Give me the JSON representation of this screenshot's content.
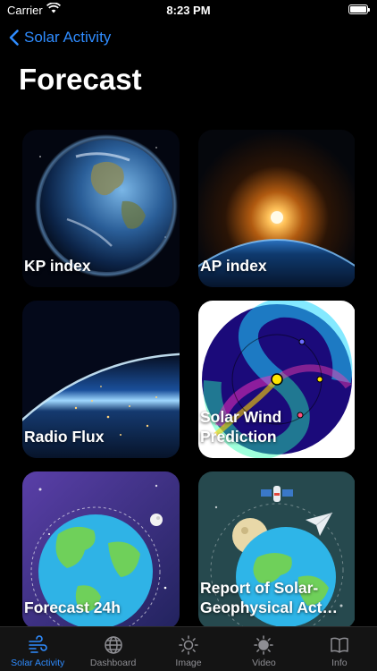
{
  "status_bar": {
    "carrier": "Carrier",
    "time": "8:23 PM"
  },
  "nav": {
    "back_label": "Solar Activity"
  },
  "page": {
    "title": "Forecast"
  },
  "cards": [
    {
      "label": "KP index",
      "image": "earth-from-space"
    },
    {
      "label": "AP index",
      "image": "sunrise-over-earth"
    },
    {
      "label": "Radio Flux",
      "image": "earth-city-lights"
    },
    {
      "label": "Solar Wind\nPrediction",
      "image": "solar-wind-spiral"
    },
    {
      "label": "Forecast 24h",
      "image": "earth-illustration"
    },
    {
      "label": "Report of Solar-\nGeophysical Act…",
      "image": "earth-satellite-illustration"
    }
  ],
  "tab_bar": {
    "selected": "Solar Activity",
    "tabs": [
      {
        "label": "Solar Activity",
        "icon": "wind-icon"
      },
      {
        "label": "Dashboard",
        "icon": "globe-icon"
      },
      {
        "label": "Image",
        "icon": "sun-outline-icon"
      },
      {
        "label": "Video",
        "icon": "sun-filled-icon"
      },
      {
        "label": "Info",
        "icon": "book-icon"
      }
    ]
  },
  "colors": {
    "accent": "#2f8cff",
    "background": "#000000",
    "tab_inactive": "#8e8e93"
  }
}
